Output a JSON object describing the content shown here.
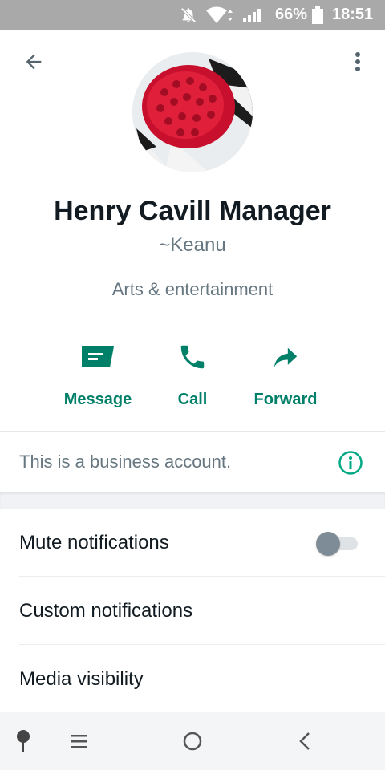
{
  "status_bar": {
    "battery_percent": "66%",
    "time": "18:51",
    "icons": [
      "mute-icon",
      "wifi-icon",
      "signal-icon",
      "battery-icon"
    ]
  },
  "profile": {
    "name": "Henry Cavill Manager",
    "alias": "~Keanu",
    "category": "Arts & entertainment"
  },
  "actions": [
    {
      "label": "Message",
      "icon": "message-icon"
    },
    {
      "label": "Call",
      "icon": "call-icon"
    },
    {
      "label": "Forward",
      "icon": "forward-icon"
    }
  ],
  "business": {
    "text": "This is a business account.",
    "icon": "info-icon"
  },
  "settings": [
    {
      "label": "Mute notifications",
      "toggle": false
    },
    {
      "label": "Custom notifications"
    },
    {
      "label": "Media visibility"
    }
  ],
  "colors": {
    "accent": "#008069",
    "status_bar": "#a9a9aa",
    "primary_text": "#111b21",
    "secondary_text": "#667781"
  }
}
